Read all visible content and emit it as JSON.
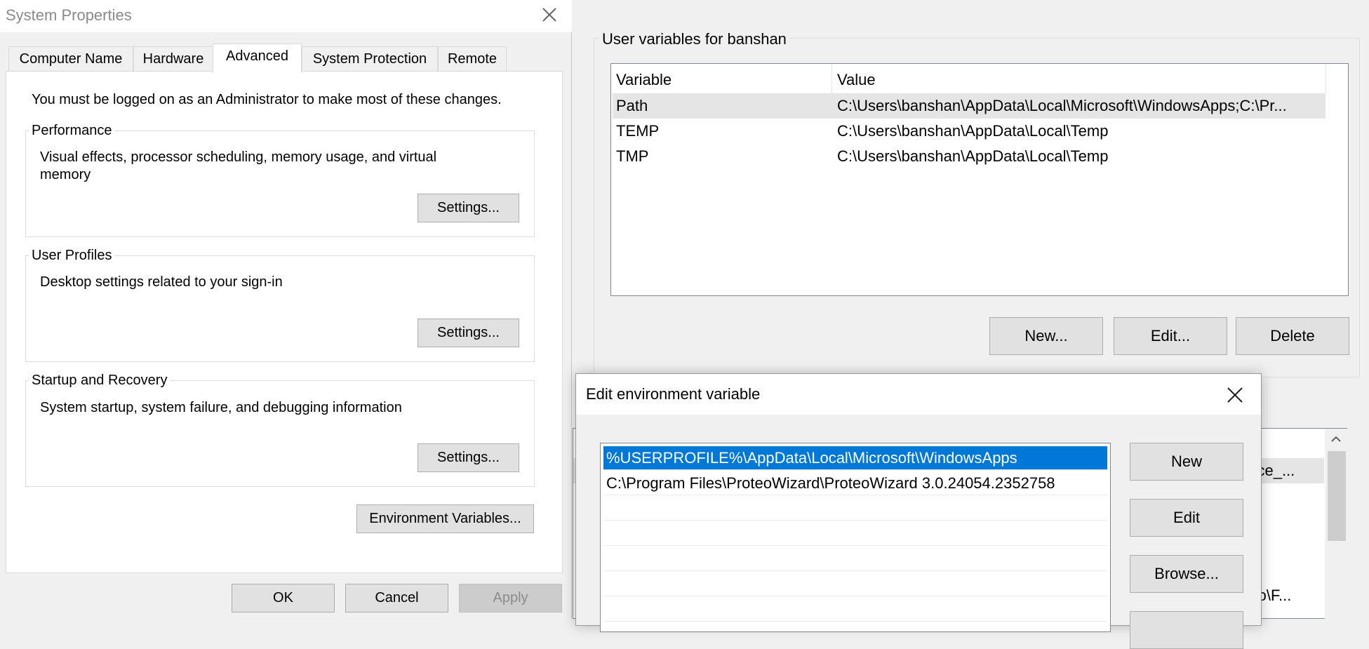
{
  "system_properties": {
    "title": "System Properties",
    "tabs": [
      {
        "label": "Computer Name",
        "active": false
      },
      {
        "label": "Hardware",
        "active": false
      },
      {
        "label": "Advanced",
        "active": true
      },
      {
        "label": "System Protection",
        "active": false
      },
      {
        "label": "Remote",
        "active": false
      }
    ],
    "admin_notice": "You must be logged on as an Administrator to make most of these changes.",
    "performance": {
      "title": "Performance",
      "description_line1": "Visual effects, processor scheduling, memory usage, and virtual",
      "description_line2": "memory",
      "button": "Settings..."
    },
    "user_profiles": {
      "title": "User Profiles",
      "description": "Desktop settings related to your sign-in",
      "button": "Settings..."
    },
    "startup_recovery": {
      "title": "Startup and Recovery",
      "description": "System startup, system failure, and debugging information",
      "button": "Settings..."
    },
    "env_button": "Environment Variables...",
    "ok": "OK",
    "cancel": "Cancel",
    "apply": "Apply"
  },
  "environment_variables": {
    "user_group_title": "User variables for banshan",
    "columns": [
      "Variable",
      "Value"
    ],
    "rows": [
      {
        "variable": "Path",
        "value": "C:\\Users\\banshan\\AppData\\Local\\Microsoft\\WindowsApps;C:\\Pr..."
      },
      {
        "variable": "TEMP",
        "value": "C:\\Users\\banshan\\AppData\\Local\\Temp"
      },
      {
        "variable": "TMP",
        "value": "C:\\Users\\banshan\\AppData\\Local\\Temp"
      }
    ],
    "new": "New...",
    "edit": "Edit...",
    "delete": "Delete",
    "system_partial_1": "ance_...",
    "system_partial_2": "rmo\\F..."
  },
  "edit_dialog": {
    "title": "Edit environment variable",
    "items": [
      "%USERPROFILE%\\AppData\\Local\\Microsoft\\WindowsApps",
      "C:\\Program Files\\ProteoWizard\\ProteoWizard 3.0.24054.2352758"
    ],
    "new": "New",
    "edit": "Edit",
    "browse": "Browse..."
  },
  "colors": {
    "selection": "#0078d7",
    "button_face": "#e1e1e1",
    "window_bg": "#f0f0f0"
  }
}
